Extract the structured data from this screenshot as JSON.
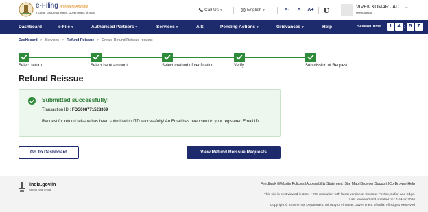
{
  "header": {
    "logo_title": "e-Filing",
    "logo_tagline": "Anywhere Anytime",
    "logo_subtitle": "Income Tax Department, Government of India",
    "call_us": "Call Us",
    "language": "English",
    "font_smaller": "A-",
    "font_normal": "A",
    "font_larger": "A+",
    "user_name": "VIVEK KUMAR JAD...",
    "user_role": "Individual"
  },
  "nav": {
    "items": [
      "Dashboard",
      "e-File",
      "Authorised Partners",
      "Services",
      "AIS",
      "Pending Actions",
      "Grievances",
      "Help"
    ],
    "session_label": "Session Time",
    "timer": [
      "1",
      "4",
      "5",
      "7"
    ]
  },
  "breadcrumb": [
    "Dashboard",
    "Services",
    "Refund Reissue",
    "Create Refund Reissue request"
  ],
  "steps": [
    "Select return",
    "Select bank account",
    "Select method of verification",
    "Verify",
    "Submission of Request"
  ],
  "page_title": "Refund Reissue",
  "success": {
    "title": "Submitted successfully!",
    "txn_label": "Transaction ID :",
    "txn_value": "FOS008771528369",
    "message": "Request for refund reissue has been submitted to ITD successfully! An Email has been sent to your registered Email ID."
  },
  "buttons": {
    "dashboard": "Go To Dashboard",
    "view_requests": "View Refund Reissue Requests"
  },
  "footer": {
    "logo": "india.gov.in",
    "logo_sub": "national portal of india",
    "links": [
      "Feedback",
      "Website Policies",
      "Accessibility Statement",
      "Site Map",
      "Browser Support",
      "Co-Browse Help"
    ],
    "best_viewed": "This site is best viewed in 1024 * 768 resolution with latest version of Chrome, Firefox, Safari and Edge.",
    "updated": "Last reviewed and updated on : 14-Mar-2026",
    "copyright": "Copyright © Income Tax Department, Ministry of Finance, Government of India. All Rights Reserved"
  },
  "colors": {
    "primary": "#1d2a6b",
    "success": "#2e8b3a",
    "success_bg": "#eef7ee"
  }
}
